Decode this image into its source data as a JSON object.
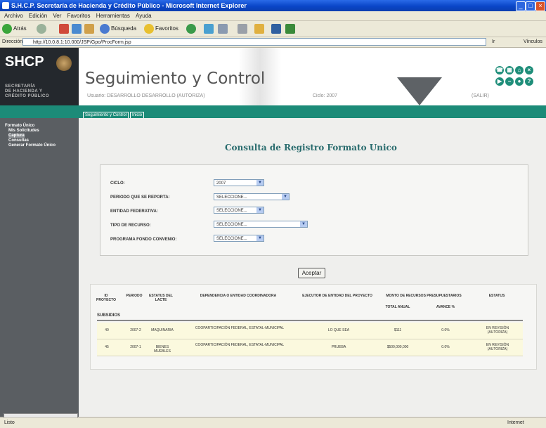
{
  "window": {
    "title": "S.H.C.P.  Secretaría de Hacienda y Crédito Público - Microsoft Internet Explorer"
  },
  "menubar": [
    "Archivo",
    "Edición",
    "Ver",
    "Favoritos",
    "Herramientas",
    "Ayuda"
  ],
  "toolbar": {
    "back": "Atrás",
    "search": "Búsqueda",
    "favorites": "Favoritos"
  },
  "addressbar": {
    "label": "Dirección",
    "url": "http://10.0.8.1:10.000/JSP/Gpo/ProcForm.jsp",
    "go": "Ir",
    "links": "Vínculos"
  },
  "header": {
    "logo": "SHCP",
    "logo_sub": [
      "SECRETARÍA",
      "DE HACIENDA Y",
      "CRÉDITO PÚBLICO"
    ],
    "app_title": "Seguimiento y Control",
    "user_line": "Usuario: DESARROLLO DESARROLLO (AUTORIZA)",
    "ciclo": "Ciclo: 2007",
    "salir": "(SALIR)"
  },
  "tabs": [
    "Seguimiento y Control",
    "Inicio"
  ],
  "sidebar": {
    "items": [
      {
        "label": "Formato Único"
      },
      {
        "label": "Mis Solicitudes"
      },
      {
        "label": "Captura"
      },
      {
        "label": "Consultas"
      },
      {
        "label": "Generar Formato Único"
      }
    ]
  },
  "page": {
    "title": "Consulta de Registro Formato Unico"
  },
  "form": {
    "fields": [
      {
        "label": "CICLO:",
        "value": "2007"
      },
      {
        "label": "PERIODO QUE SE REPORTA:",
        "value": "SELECCIONE..."
      },
      {
        "label": "ENTIDAD FEDERATIVA:",
        "value": "SELECCIONE..."
      },
      {
        "label": "TIPO DE RECURSO:",
        "value": "SELECCIONE..."
      },
      {
        "label": "PROGRAMA FONDO CONVENIO:",
        "value": "SELECCIONE..."
      }
    ],
    "submit": "Aceptar"
  },
  "table": {
    "headers": {
      "id": "ID PROYECTO",
      "periodo": "PERIODO",
      "estatus_del_lacte": "ESTATUS DEL LACTE",
      "dependencia": "DEPENDENCIA O ENTIDAD COORDINADORA",
      "ejecutor": "EJECUTOR DE ENTIDAD DEL PROYECTO",
      "monto": "MONTO DE RECURSOS PRESUPUESTARIOS",
      "total_anual": "TOTAL ANUAL",
      "avance": "AVANCE %",
      "estatus": "ESTATUS"
    },
    "group_label": "SUBSIDIOS",
    "rows": [
      {
        "id": "40",
        "periodo": "2007-2",
        "lacte": "MAQUINARIA",
        "dependencia": "COOPARTICIPACIÓN FEDERAL, ESTATAL-MUNICIPAL",
        "ejecutor": "LO QUE SEA",
        "total": "$111",
        "avance": "0.0%",
        "estatus": "EN REVISIÓN (AUTORIZA)"
      },
      {
        "id": "45",
        "periodo": "2007-1",
        "lacte": "BIENES MUEBLES",
        "dependencia": "COOPARTICIPACIÓN FEDERAL, ESTATAL-MUNICIPAL",
        "ejecutor": "PRUEBA",
        "total": "$500,000,000",
        "avance": "0.0%",
        "estatus": "EN REVISIÓN (AUTORIZA)"
      }
    ]
  },
  "statusbar": {
    "left": "Listo",
    "right": "Internet"
  },
  "colors": {
    "accent_green": "#1c8b78",
    "title_blue": "#0a46c8",
    "sidebar_gray": "#5a5e62",
    "page_title": "#2a6c6e"
  }
}
